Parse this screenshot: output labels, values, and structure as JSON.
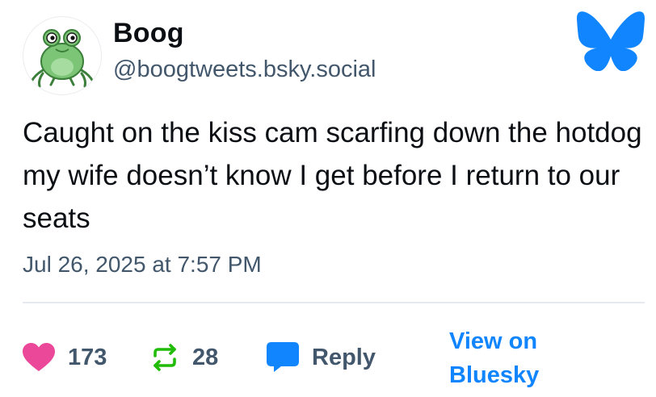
{
  "author": {
    "display_name": "Boog",
    "handle": "@boogtweets.bsky.social",
    "avatar_icon": "frog-avatar"
  },
  "brand": {
    "logo_icon": "bluesky-butterfly-icon",
    "color": "#1185fe"
  },
  "post": {
    "text": "Caught on the kiss cam scarfing down the hotdog my wife doesn’t know I get before I return to our seats",
    "timestamp": "Jul 26, 2025 at 7:57 PM"
  },
  "actions": {
    "likes": "173",
    "reposts": "28",
    "reply_label": "Reply",
    "view_on_line1": "View on",
    "view_on_line2": "Bluesky"
  },
  "colors": {
    "like": "#ec4899",
    "repost": "#20bc07",
    "reply": "#1185fe",
    "muted_text": "#42576c"
  }
}
